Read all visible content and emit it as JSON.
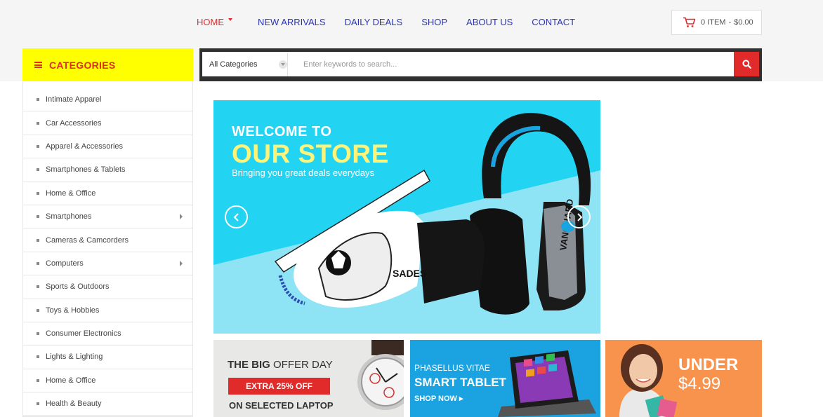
{
  "nav": {
    "items": [
      {
        "label": "HOME",
        "active": true
      },
      {
        "label": "NEW ARRIVALS"
      },
      {
        "label": "DAILY DEALS"
      },
      {
        "label": "SHOP"
      },
      {
        "label": "ABOUT US"
      },
      {
        "label": "CONTACT"
      }
    ]
  },
  "cart": {
    "items": "0 ITEM",
    "separator": "-",
    "total": "$0.00"
  },
  "categories": {
    "title": "CATEGORIES",
    "items": [
      {
        "label": "Intimate Apparel"
      },
      {
        "label": "Car Accessories"
      },
      {
        "label": "Apparel & Accessories"
      },
      {
        "label": "Smartphones & Tablets"
      },
      {
        "label": "Home & Office"
      },
      {
        "label": "Smartphones",
        "has_sub": true
      },
      {
        "label": "Cameras & Camcorders"
      },
      {
        "label": "Computers",
        "has_sub": true
      },
      {
        "label": "Sports & Outdoors"
      },
      {
        "label": "Toys & Hobbies"
      },
      {
        "label": "Consumer Electronics"
      },
      {
        "label": "Lights & Lighting"
      },
      {
        "label": "Home & Office"
      },
      {
        "label": "Health & Beauty"
      }
    ]
  },
  "search": {
    "category": "All Categories",
    "placeholder": "Enter keywords to search..."
  },
  "slider": {
    "line1": "WELCOME TO",
    "line2": "OUR STORE",
    "line3": "Bringing you great deals everydays",
    "headphone_brand": "SADES",
    "headphone_model": "VANGUARD"
  },
  "banners": {
    "b1": {
      "title_bold": "THE BIG",
      "title_rest": " OFFER DAY",
      "badge": "EXTRA 25% OFF",
      "sub": "ON SELECTED LAPTOP"
    },
    "b2": {
      "title": "PHASELLUS VITAE",
      "big": "SMART TABLET",
      "link": "SHOP NOW"
    },
    "b3": {
      "line1": "UNDER",
      "line2": "$4.99"
    }
  },
  "colors": {
    "accent": "#e12b2b",
    "nav": "#2a35b5",
    "category_header": "#ffff00",
    "slider_bg": "#22d4f2"
  }
}
